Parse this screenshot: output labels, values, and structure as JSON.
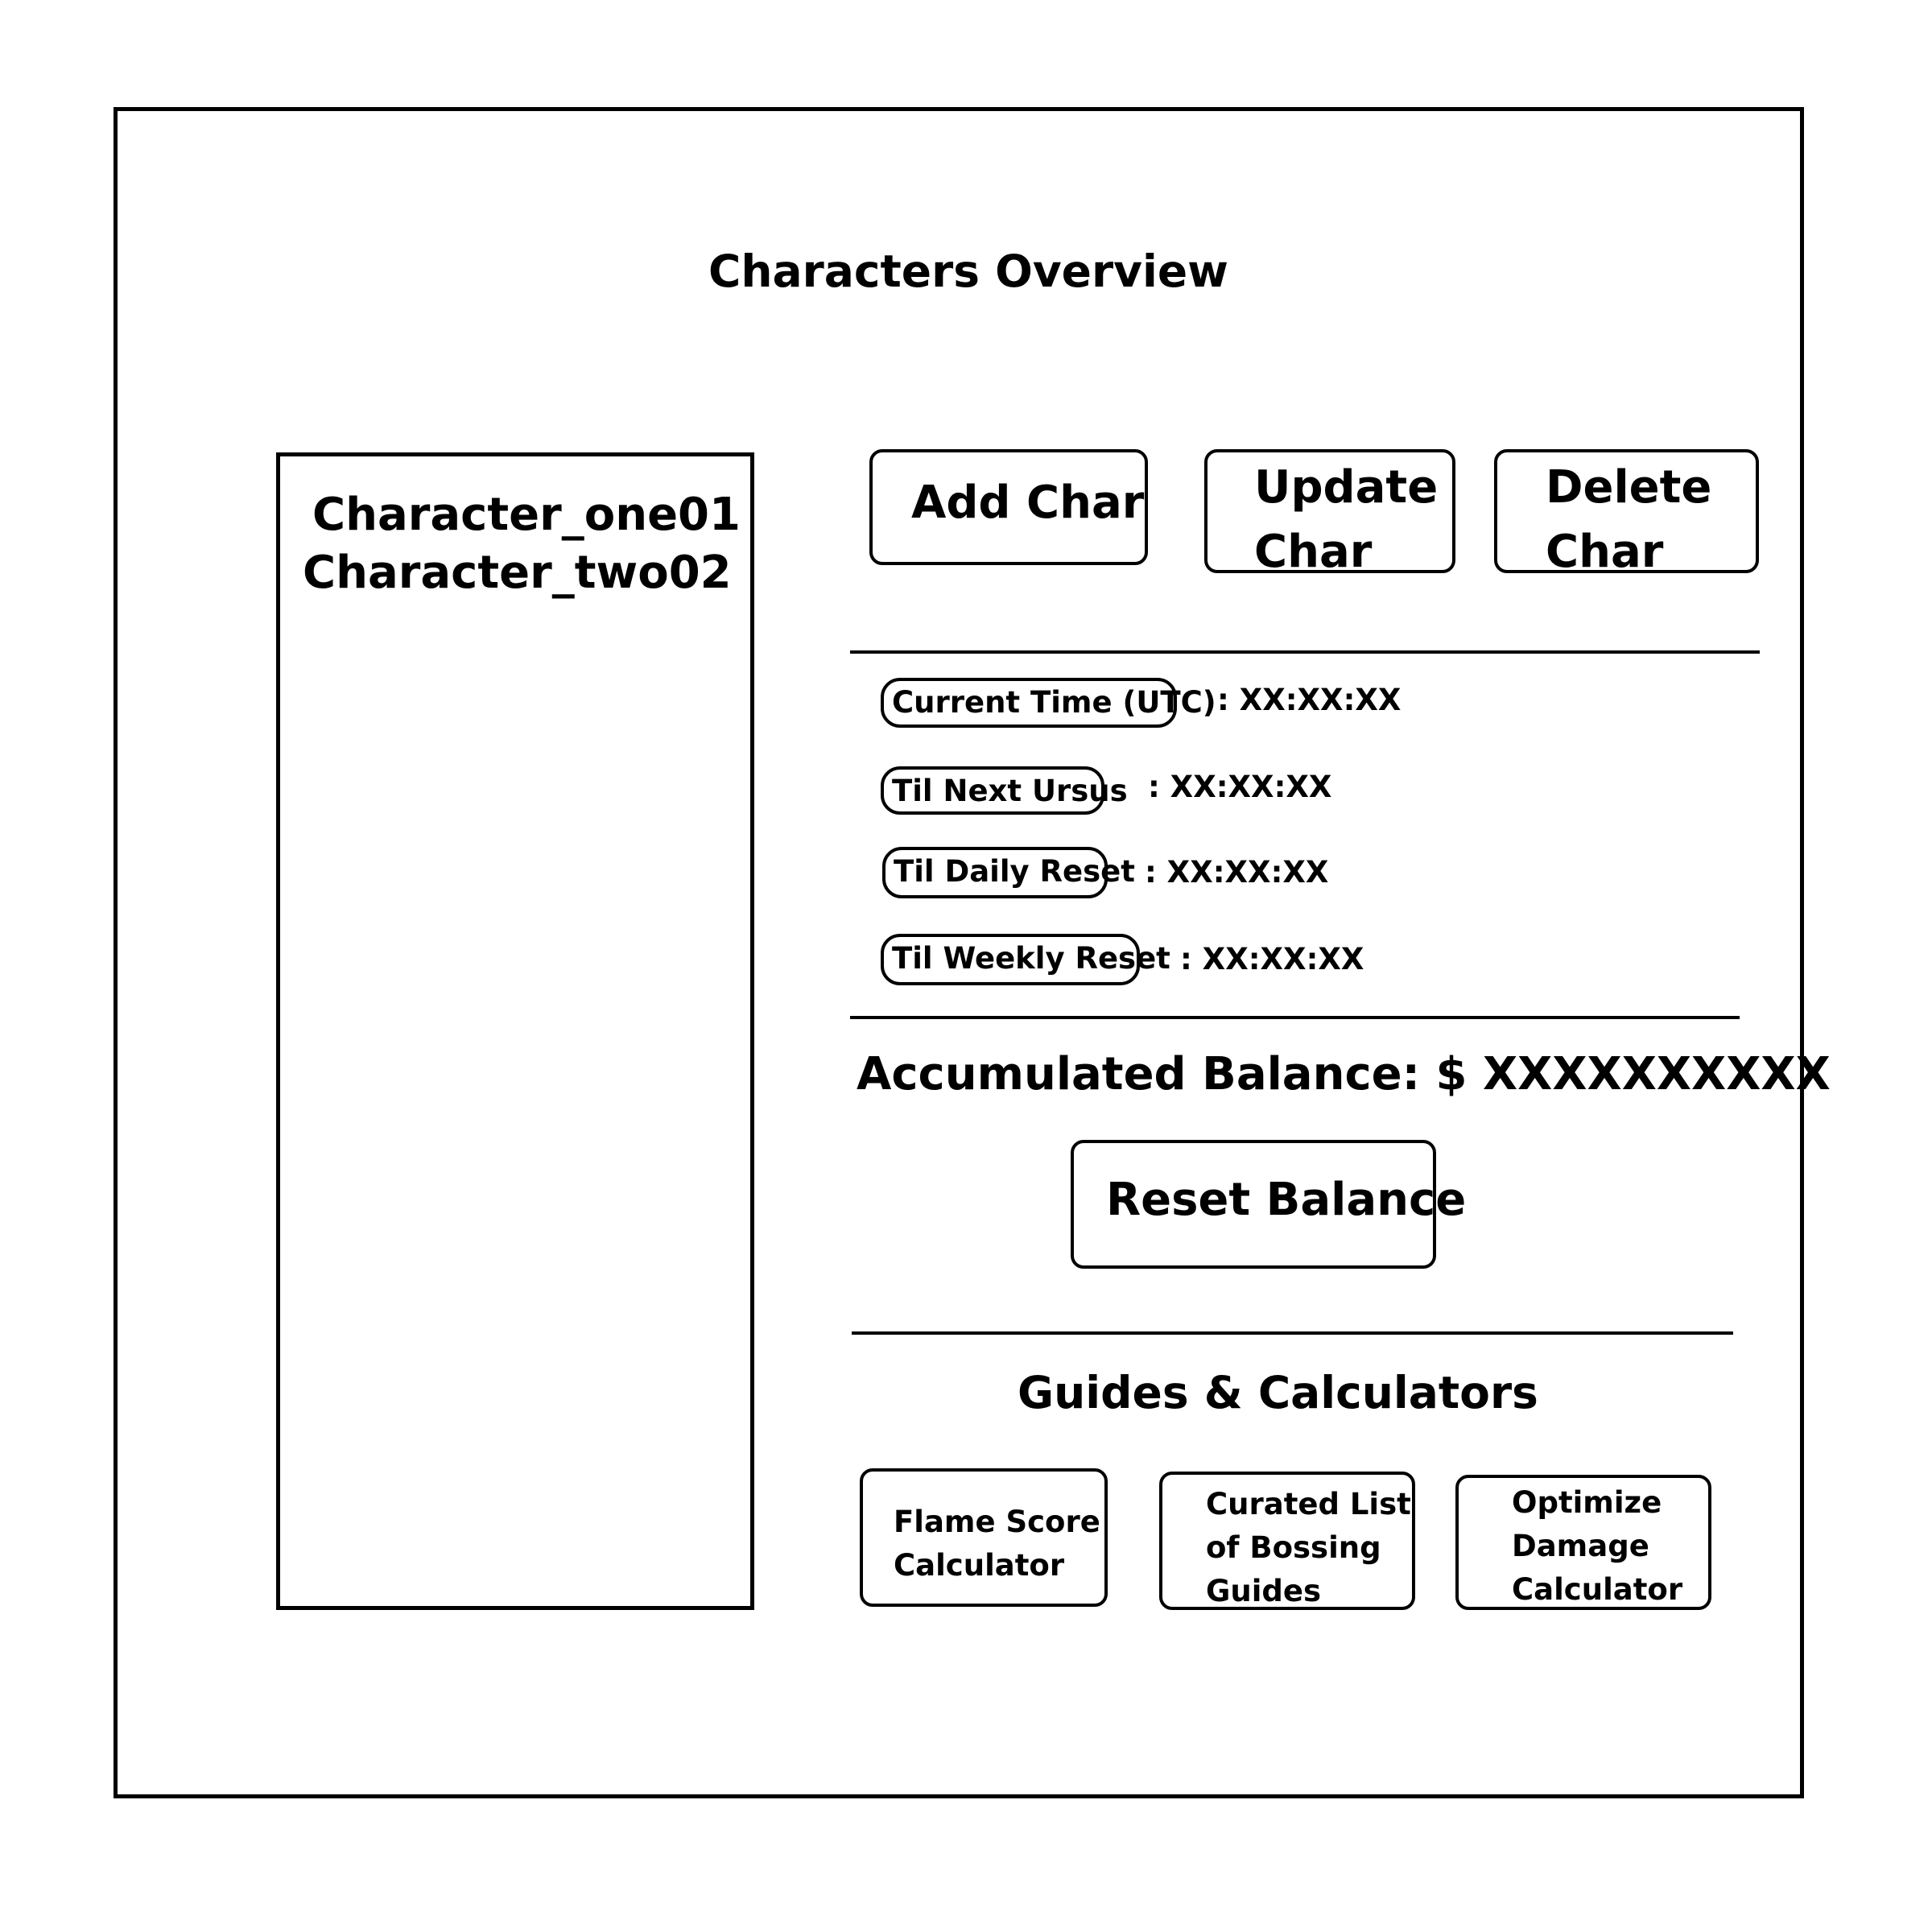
{
  "page": {
    "title": "Characters Overview"
  },
  "characters": {
    "items": [
      {
        "name": "Character_one01"
      },
      {
        "name": "Character_two02"
      }
    ]
  },
  "actions": {
    "add_label": "Add Char",
    "update_label": "Update\nChar",
    "delete_label": "Delete\nChar"
  },
  "timers": [
    {
      "label": "Current Time (UTC)",
      "value": ": XX:XX:XX"
    },
    {
      "label": "Til Next Ursus",
      "value": ": XX:XX:XX"
    },
    {
      "label": "Til Daily Reset",
      "value": ": XX:XX:XX"
    },
    {
      "label": "Til Weekly Reset",
      "value": ": XX:XX:XX"
    }
  ],
  "balance": {
    "label": "Accumulated Balance: $ XXXXXXXXXX",
    "reset_label": "Reset Balance"
  },
  "guides": {
    "title": "Guides & Calculators",
    "items": [
      {
        "label": "Flame Score\nCalculator"
      },
      {
        "label": "Curated List\nof Bossing\nGuides"
      },
      {
        "label": "Optimize\nDamage\nCalculator"
      }
    ]
  }
}
